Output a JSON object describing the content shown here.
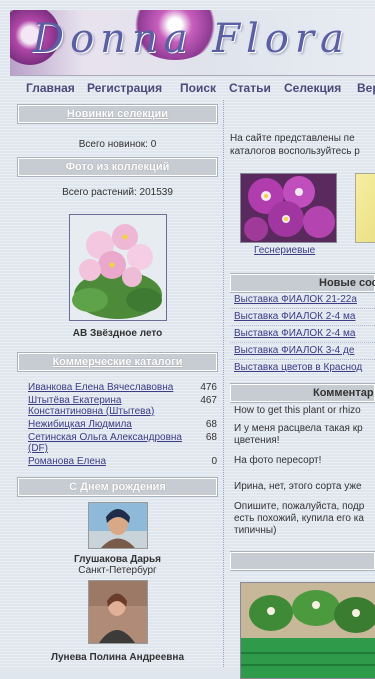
{
  "banner": {
    "title": "Donna Flora"
  },
  "nav": {
    "items": [
      "Главная",
      "Регистрация",
      "Поиск",
      "Статьи",
      "Селекция",
      "Вер"
    ]
  },
  "left": {
    "news": {
      "title": "Новинки селекции",
      "text": "Всего новинок: 0"
    },
    "collection": {
      "title": "Фото из коллекций",
      "count_text": "Всего растений: 201539",
      "photo_caption": "АВ Звёздное лето"
    },
    "catalogs": {
      "title": "Коммерческие каталоги",
      "rows": [
        {
          "name": "Иванкова Елена Вячеславовна",
          "count": "476"
        },
        {
          "name": "Штытёва Екатерина Константиновна (Штытева)",
          "count": "467"
        },
        {
          "name": "Нежибицкая Людмила",
          "count": "68"
        },
        {
          "name": "Сетинская Ольга Александровна (DF)",
          "count": "68"
        },
        {
          "name": "Романова Елена",
          "count": "0"
        }
      ]
    },
    "birthday": {
      "title": "С Днем рождения",
      "people": [
        {
          "name": "Глушакова Дарья",
          "city": "Санкт-Петербург"
        },
        {
          "name": "Лунева Полина Андреевна",
          "city": ""
        }
      ]
    }
  },
  "right": {
    "intro_line1": "На сайте представлены пе",
    "intro_line2": "каталогов воспользуйтесь р",
    "gallery_caption": "Геснериевые",
    "new_head": "Новые сос",
    "new_links": [
      "Выставка ФИАЛОК 21-22а",
      "Выставка ФИАЛОК 2-4 ма",
      "Выставка ФИАЛОК 2-4 ма",
      "Выставка ФИАЛОК 3-4 де",
      "Выставка цветов в Краснод"
    ],
    "comments_head": "Комментар",
    "comments": [
      [
        "How to get this plant or rhizo"
      ],
      [
        "И у меня расцвела такая кр",
        "цветения!"
      ],
      [
        "На фото пересорт!"
      ],
      [
        "Ирина, нет, этого сорта уже"
      ],
      [
        "Опишите, пожалуйста, подр",
        "есть похожий, купила его ка",
        "типичны)"
      ]
    ]
  },
  "colors": {
    "accent": "#3d3d86",
    "header_bg": "#c7ccd3",
    "page_bg": "#dfe6ee"
  }
}
